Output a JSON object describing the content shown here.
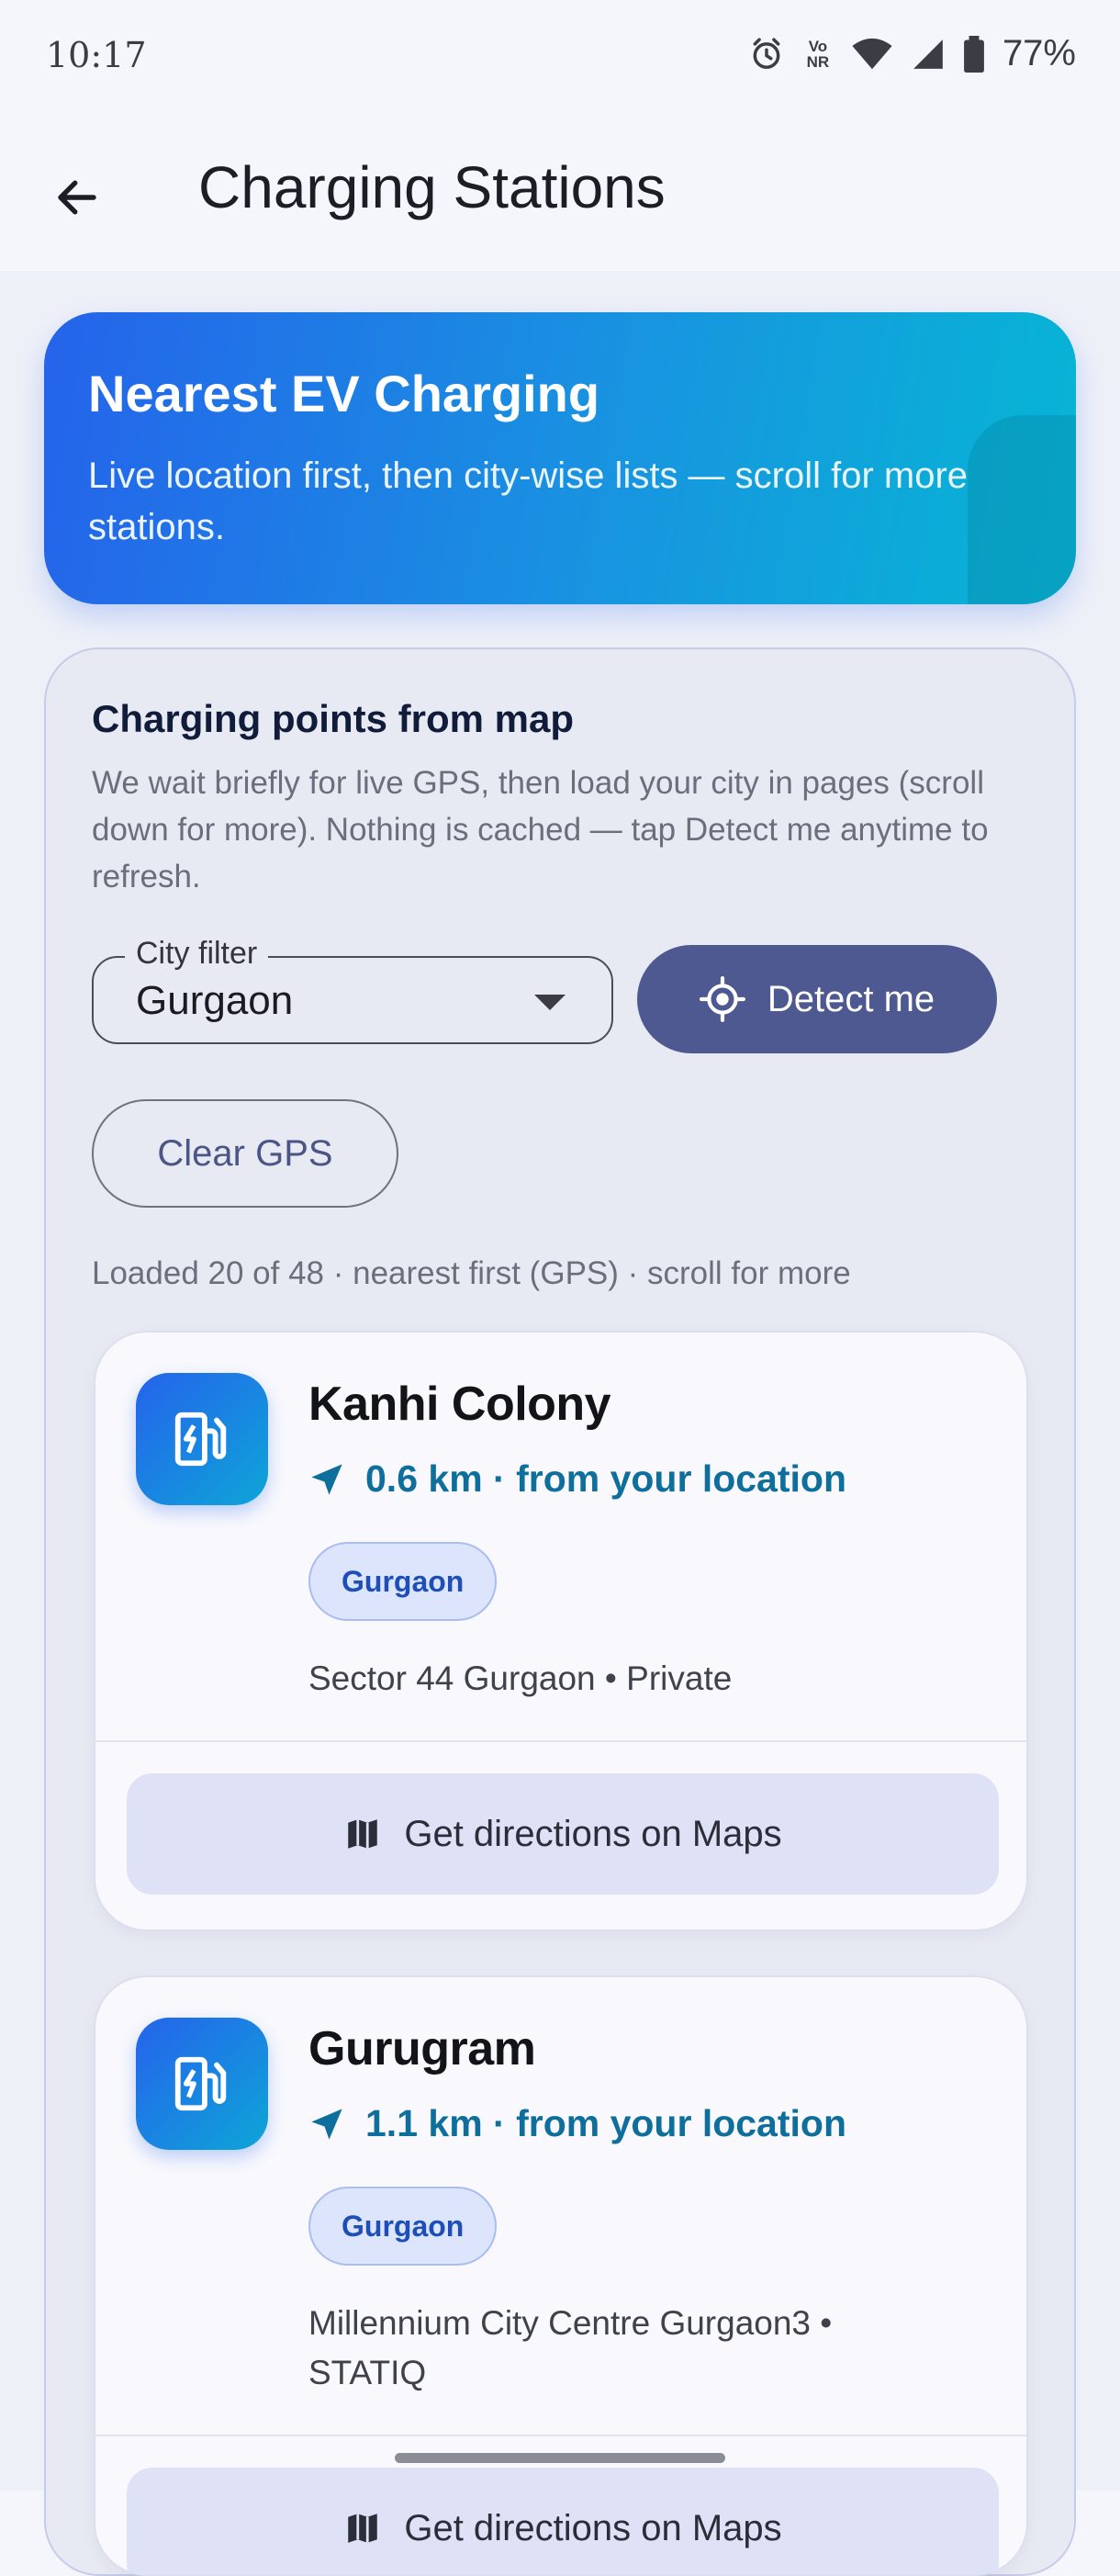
{
  "status_bar": {
    "time": "10:17",
    "network_label": "Vo NR",
    "battery": "77%",
    "icons": [
      "alarm-icon",
      "volte-icon",
      "wifi-icon",
      "signal-icon",
      "battery-icon"
    ]
  },
  "app_bar": {
    "title": "Charging Stations",
    "back_icon": "arrow-back-icon"
  },
  "hero": {
    "title": "Nearest EV Charging",
    "subtitle": "Live location first, then city-wise lists — scroll for more stations."
  },
  "panel": {
    "title": "Charging points from map",
    "description": "We wait briefly for live GPS, then load your city in pages (scroll down for more). Nothing is cached — tap Detect me anytime to refresh.",
    "city_filter": {
      "label": "City filter",
      "value": "Gurgaon"
    },
    "detect_button": "Detect me",
    "clear_button": "Clear GPS",
    "loaded_text": "Loaded 20 of 48 · nearest first (GPS) · scroll for more"
  },
  "stations": [
    {
      "name": "Kanhi Colony",
      "distance": "0.6 km · from your location",
      "city": "Gurgaon",
      "address": "Sector 44 Gurgaon • Private",
      "action": "Get directions on Maps"
    },
    {
      "name": "Gurugram",
      "distance": "1.1 km · from your location",
      "city": "Gurgaon",
      "address": "Millennium City Centre Gurgaon3 • STATIQ",
      "action": "Get directions on Maps"
    }
  ],
  "colors": {
    "accent": "#4e5991",
    "hero_start": "#2563eb",
    "hero_end": "#06b6d4",
    "distance": "#0e6f9c",
    "chip": "#dce5fb"
  }
}
